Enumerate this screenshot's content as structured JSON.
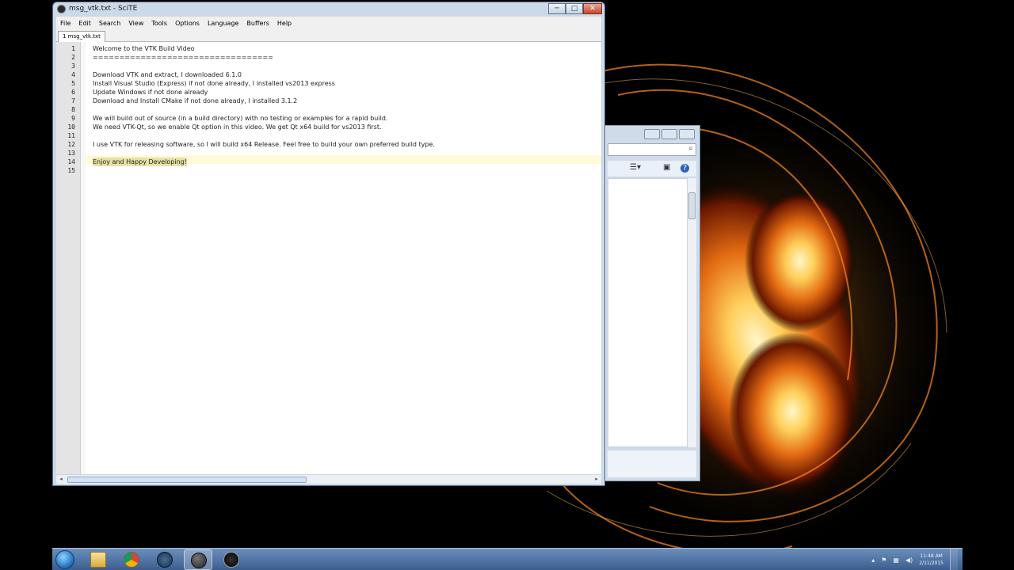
{
  "window": {
    "title": "msg_vtk.txt - SciTE",
    "minimize": "─",
    "maximize": "□",
    "close": "✕"
  },
  "menu": [
    "File",
    "Edit",
    "Search",
    "View",
    "Tools",
    "Options",
    "Language",
    "Buffers",
    "Help"
  ],
  "tab": {
    "label": "1 msg_vtk.txt"
  },
  "editor": {
    "lines": [
      {
        "n": "1",
        "text": "Welcome to the VTK Build Video"
      },
      {
        "n": "2",
        "text": "=================================="
      },
      {
        "n": "3",
        "text": ""
      },
      {
        "n": "4",
        "text": "Download VTK and extract, I downloaded 6.1.0"
      },
      {
        "n": "5",
        "text": "Install Visual Studio (Express) if not done already, I installed vs2013 express"
      },
      {
        "n": "6",
        "text": "Update Windows if not done already"
      },
      {
        "n": "7",
        "text": "Download and Install CMake if not done already, I installed 3.1.2"
      },
      {
        "n": "8",
        "text": ""
      },
      {
        "n": "9",
        "text": "We will build out of source (in a build directory) with no testing or examples for a rapid build."
      },
      {
        "n": "10",
        "text": "We need VTK-Qt, so we enable Qt option in this video. We get Qt x64 build for vs2013 first."
      },
      {
        "n": "11",
        "text": ""
      },
      {
        "n": "12",
        "text": "I use VTK for releasing software, so I will build x64 Release. Feel free to build your own preferred build type."
      },
      {
        "n": "13",
        "text": ""
      },
      {
        "n": "14",
        "text": "Enjoy and Happy Developing!"
      },
      {
        "n": "15",
        "text": ""
      }
    ]
  },
  "scroll": {
    "left": "◂",
    "right": "▸"
  },
  "background_window": {
    "search_glyph": "⌕",
    "help_glyph": "?"
  },
  "taskbar": {
    "tray_up": "▴",
    "tray_flag": "⚑",
    "clock_time": "11:48 AM",
    "clock_date": "2/11/2015"
  },
  "colors": {
    "caret_line": "#fffbd9",
    "selection": "#e6e2a6",
    "gutter": "#e4e4e4"
  }
}
